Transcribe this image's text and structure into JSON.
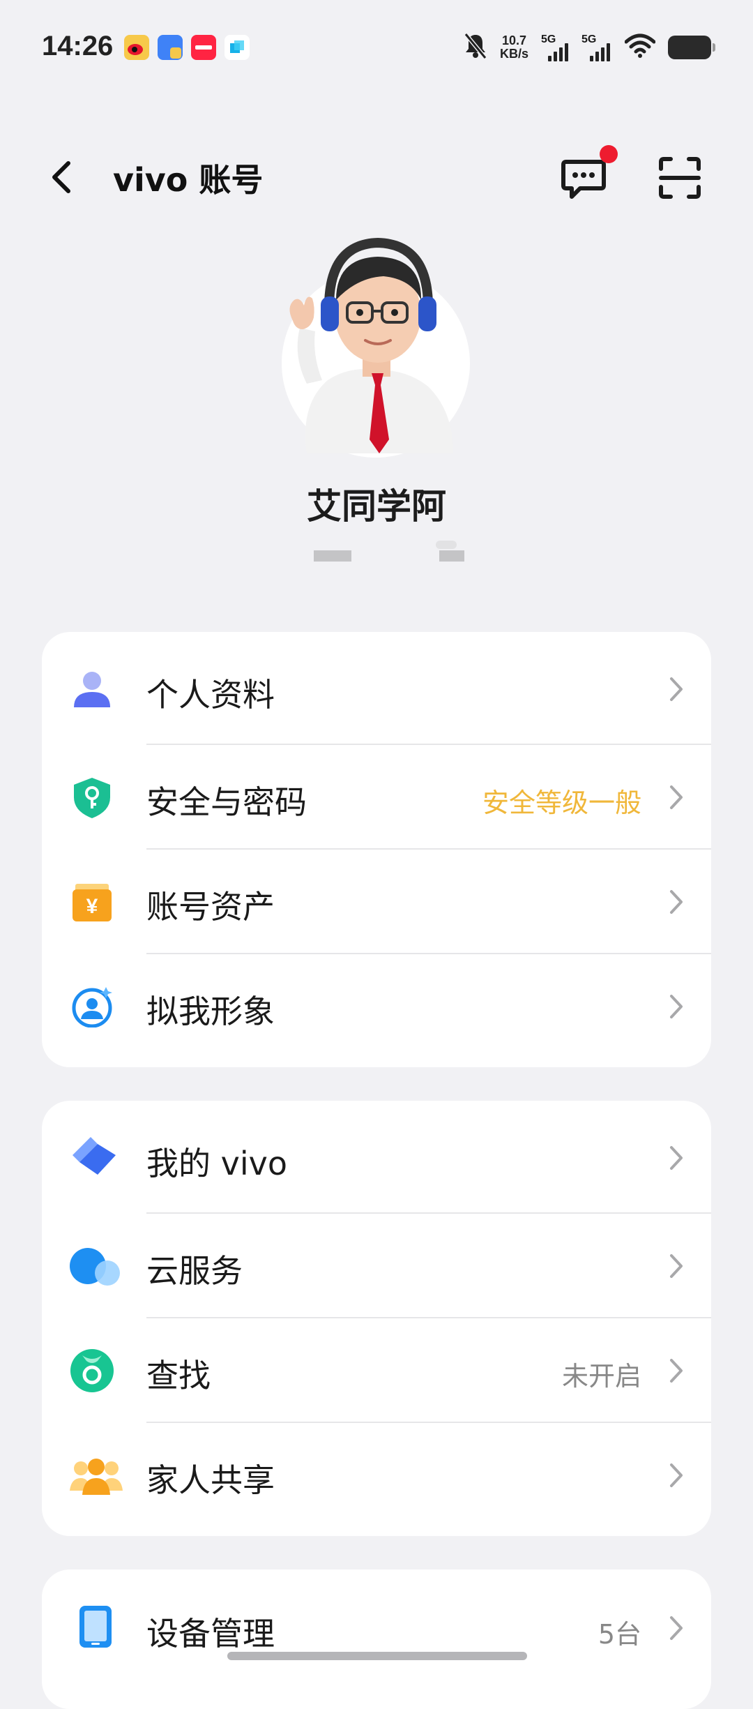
{
  "status_bar": {
    "time": "14:26",
    "net_speed_value": "10.7",
    "net_speed_unit": "KB/s",
    "sim1_label": "5G",
    "sim2_label": "5G",
    "notification_icons": [
      "weibo-icon",
      "app-icon",
      "xiaohongshu-icon",
      "app-icon"
    ]
  },
  "header": {
    "title": "vivo 账号",
    "back_icon": "chevron-left-icon",
    "message_icon": "chat-bubble-icon",
    "scan_icon": "scan-icon"
  },
  "profile": {
    "name": "艾同学阿"
  },
  "colors": {
    "background": "#f1f1f4",
    "card": "#ffffff",
    "security_warning": "#f0b73a",
    "muted_value": "#888888",
    "badge_red": "#ee1c2f"
  },
  "card1": {
    "rows": [
      {
        "label": "个人资料",
        "value": "",
        "icon": "person-icon"
      },
      {
        "label": "安全与密码",
        "value": "安全等级一般",
        "icon": "shield-key-icon"
      },
      {
        "label": "账号资产",
        "value": "",
        "icon": "wallet-yen-icon"
      },
      {
        "label": "拟我形象",
        "value": "",
        "icon": "avatar-sparkle-icon"
      }
    ]
  },
  "card2": {
    "rows": [
      {
        "label": "我的 vivo",
        "value": "",
        "icon": "vivo-diamond-icon"
      },
      {
        "label": "云服务",
        "value": "",
        "icon": "cloud-icon"
      },
      {
        "label": "查找",
        "value": "未开启",
        "icon": "find-location-icon"
      },
      {
        "label": "家人共享",
        "value": "",
        "icon": "family-icon"
      }
    ]
  },
  "card3": {
    "rows": [
      {
        "label": "设备管理",
        "value": "5台",
        "icon": "phone-device-icon"
      }
    ]
  }
}
